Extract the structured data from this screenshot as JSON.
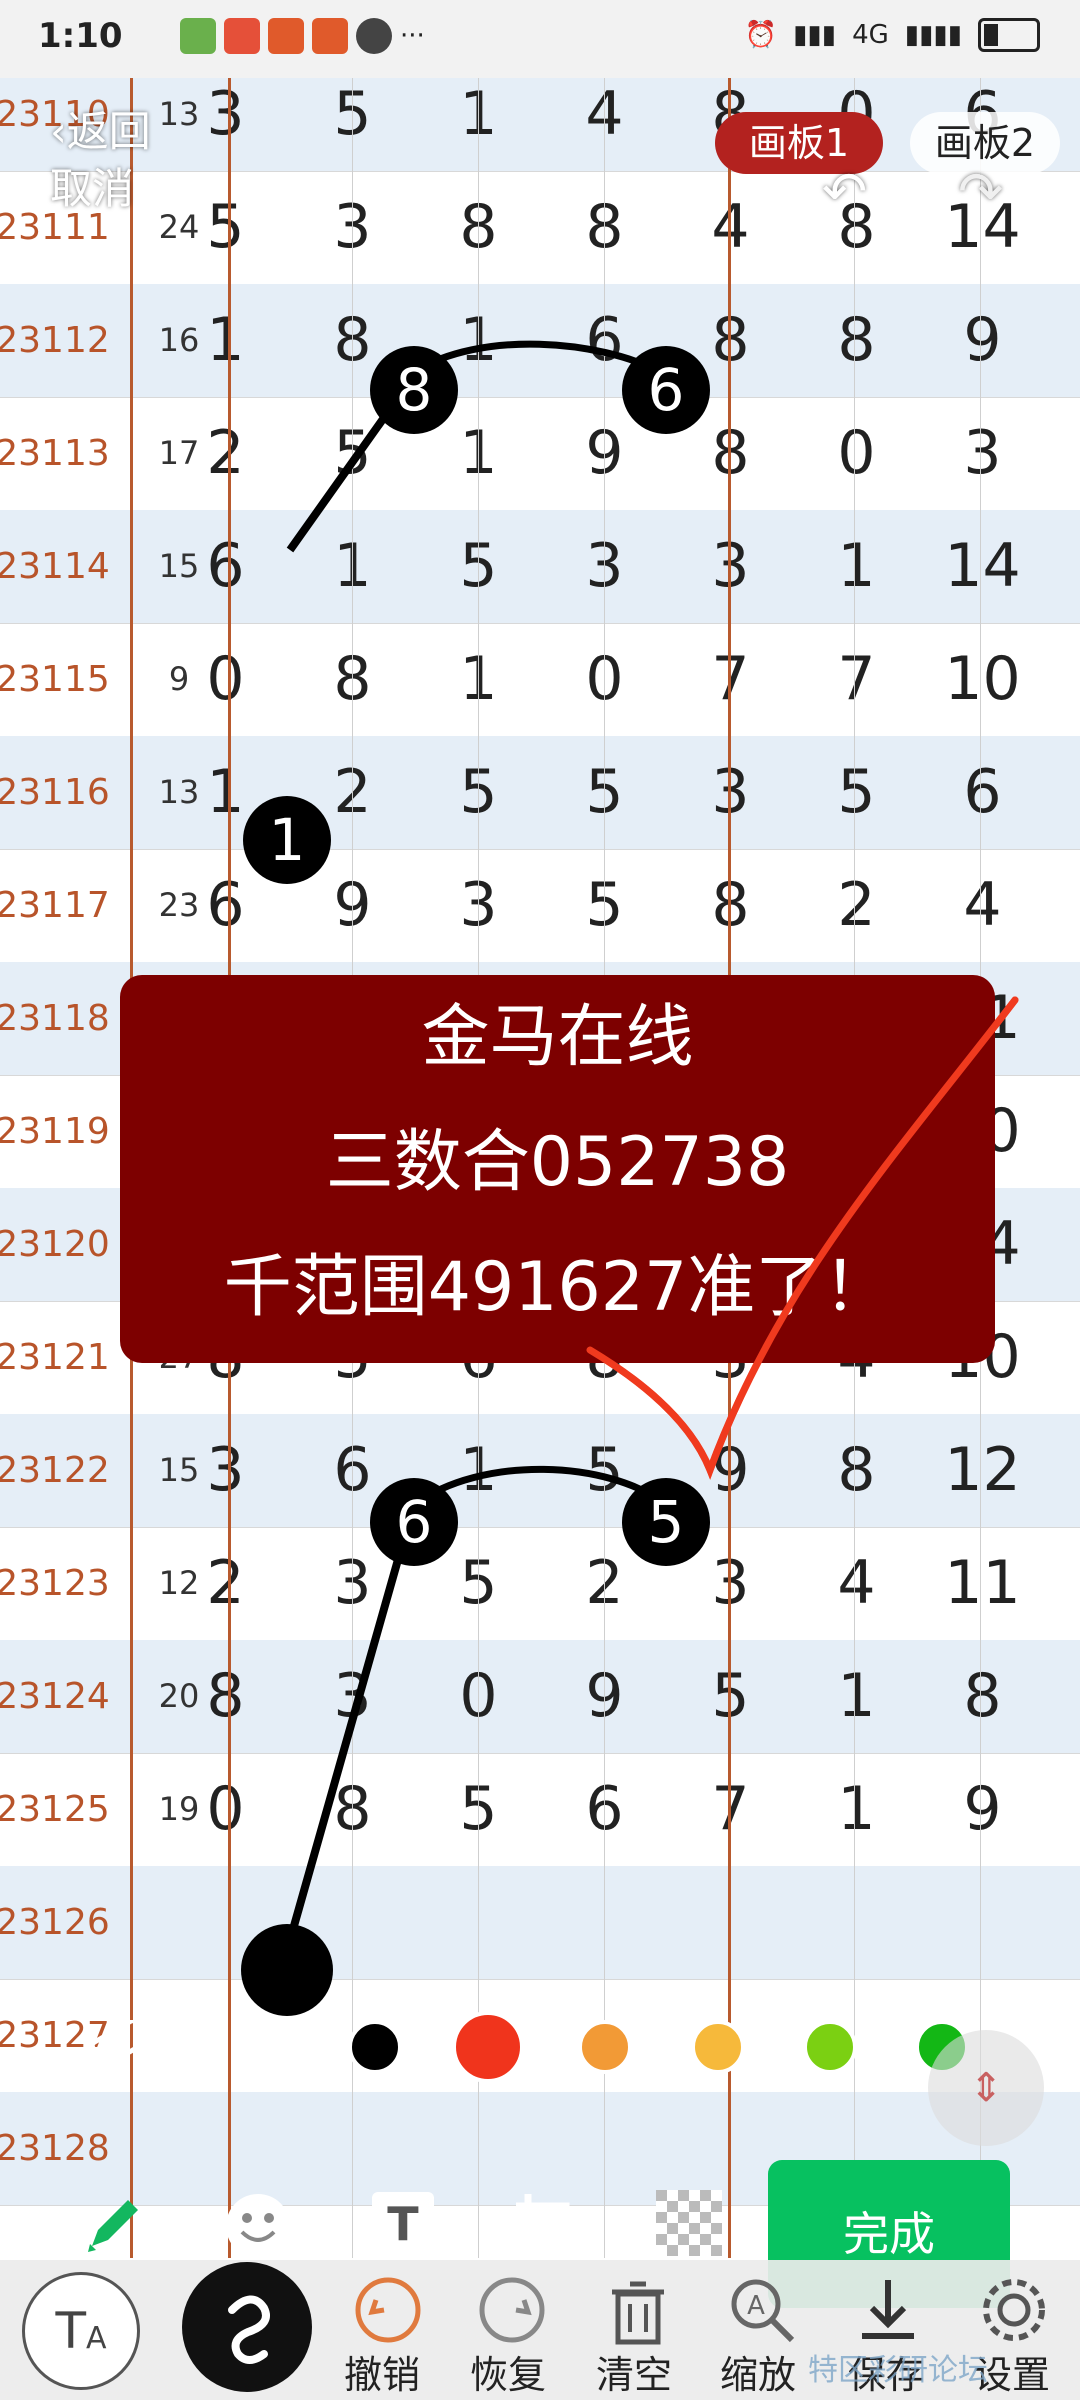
{
  "status_bar": {
    "time": "1:10",
    "icons": [
      "app-icon",
      "app-icon",
      "taobao-icon",
      "taobao-icon",
      "chat-icon",
      "more-icon"
    ],
    "signal": "4G",
    "more": "···"
  },
  "nav": {
    "back_label": "返回",
    "cancel_label": "取消",
    "board1_label": "画板1",
    "board2_label": "画板2"
  },
  "rows": [
    {
      "id": "23110",
      "sum": "13",
      "d": [
        "3",
        "5",
        "1",
        "4",
        "8",
        "0",
        "6"
      ]
    },
    {
      "id": "23111",
      "sum": "24",
      "d": [
        "5",
        "3",
        "8",
        "8",
        "4",
        "8",
        "14"
      ]
    },
    {
      "id": "23112",
      "sum": "16",
      "d": [
        "1",
        "8",
        "1",
        "6",
        "8",
        "8",
        "9"
      ]
    },
    {
      "id": "23113",
      "sum": "17",
      "d": [
        "2",
        "5",
        "1",
        "9",
        "8",
        "0",
        "3"
      ]
    },
    {
      "id": "23114",
      "sum": "15",
      "d": [
        "6",
        "1",
        "5",
        "3",
        "3",
        "1",
        "14"
      ]
    },
    {
      "id": "23115",
      "sum": "9",
      "d": [
        "0",
        "8",
        "1",
        "0",
        "7",
        "7",
        "10"
      ]
    },
    {
      "id": "23116",
      "sum": "13",
      "d": [
        "1",
        "2",
        "5",
        "5",
        "3",
        "5",
        "6"
      ]
    },
    {
      "id": "23117",
      "sum": "23",
      "d": [
        "6",
        "9",
        "3",
        "5",
        "8",
        "2",
        "4"
      ]
    },
    {
      "id": "23118",
      "sum": "",
      "d": [
        "",
        "",
        "",
        "",
        "",
        "",
        "11"
      ]
    },
    {
      "id": "23119",
      "sum": "",
      "d": [
        "",
        "",
        "",
        "",
        "",
        "",
        "10"
      ]
    },
    {
      "id": "23120",
      "sum": "",
      "d": [
        "",
        "",
        "",
        "",
        "",
        "",
        "14"
      ]
    },
    {
      "id": "23121",
      "sum": "27",
      "d": [
        "8",
        "5",
        "6",
        "8",
        "3",
        "4",
        "10"
      ]
    },
    {
      "id": "23122",
      "sum": "15",
      "d": [
        "3",
        "6",
        "1",
        "5",
        "9",
        "8",
        "12"
      ]
    },
    {
      "id": "23123",
      "sum": "12",
      "d": [
        "2",
        "3",
        "5",
        "2",
        "3",
        "4",
        "11"
      ]
    },
    {
      "id": "23124",
      "sum": "20",
      "d": [
        "8",
        "3",
        "0",
        "9",
        "5",
        "1",
        "8"
      ]
    },
    {
      "id": "23125",
      "sum": "19",
      "d": [
        "0",
        "8",
        "5",
        "6",
        "7",
        "1",
        "9"
      ]
    },
    {
      "id": "23126",
      "sum": "",
      "d": [
        "",
        "",
        "",
        "",
        "",
        "",
        ""
      ]
    },
    {
      "id": "23127",
      "sum": "",
      "d": [
        "",
        "",
        "",
        "",
        "",
        "",
        ""
      ]
    },
    {
      "id": "23128",
      "sum": "",
      "d": [
        "",
        "",
        "",
        "",
        "",
        "",
        ""
      ]
    }
  ],
  "marks": {
    "top": [
      "8",
      "6",
      "1"
    ],
    "bottom": [
      "6",
      "5"
    ]
  },
  "caption": {
    "line1": "金马在线",
    "line2": "三数合052738",
    "line3": "千范围491627准了！"
  },
  "palette": {
    "colors": [
      "#ffffff",
      "#000000",
      "#f0341c",
      "#f29a36",
      "#f6b93b",
      "#7bd012",
      "#13b715"
    ],
    "selected": "#f0341c"
  },
  "tools": {
    "done_label": "完成"
  },
  "bottom": {
    "undo": "撤销",
    "redo": "恢复",
    "clear": "清空",
    "zoom": "缩放",
    "save": "保存",
    "settings": "设置"
  }
}
